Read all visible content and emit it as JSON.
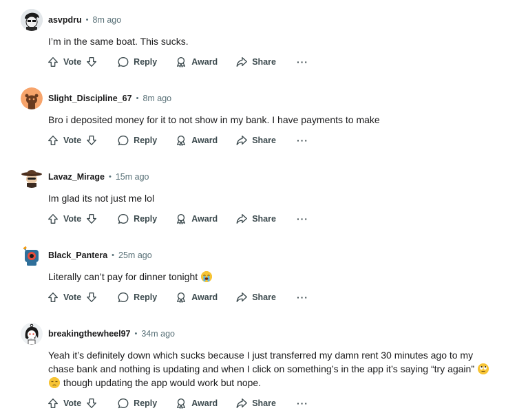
{
  "actions": {
    "vote": "Vote",
    "reply": "Reply",
    "award": "Award",
    "share": "Share",
    "more": "···"
  },
  "comments": [
    {
      "username": "asvpdru",
      "time": "8m ago",
      "text": "I’m in the same boat. This sucks.",
      "avatar": "black-hair-avatar"
    },
    {
      "username": "Slight_Discipline_67",
      "time": "8m ago",
      "text": "Bro i deposited money for it to not show in my bank. I have payments to make",
      "avatar": "default-snoo-avatar"
    },
    {
      "username": "Lavaz_Mirage",
      "time": "15m ago",
      "text": "Im glad its not just me lol",
      "avatar": "cowboy-hat-avatar"
    },
    {
      "username": "Black_Pantera",
      "time": "25m ago",
      "text": "Literally can’t pay for dinner tonight",
      "emoji": "loudly-crying-face-emoji",
      "avatar": "robot-avatar"
    },
    {
      "username": "breakingthewheel97",
      "time": "34m ago",
      "text_line1": "Yeah it’s definitely down which sucks because I just transferred my damn rent 30 minutes ago to my",
      "text_line2": "chase bank and nothing is updating and when I click on something’s in the app it’s saying “try again”",
      "text_line3": "though updating the app would work but nope.",
      "emoji1": "rolling-eyes-emoji",
      "emoji2": "unamused-face-emoji",
      "avatar": "snoo-black-hair-avatar"
    }
  ]
}
